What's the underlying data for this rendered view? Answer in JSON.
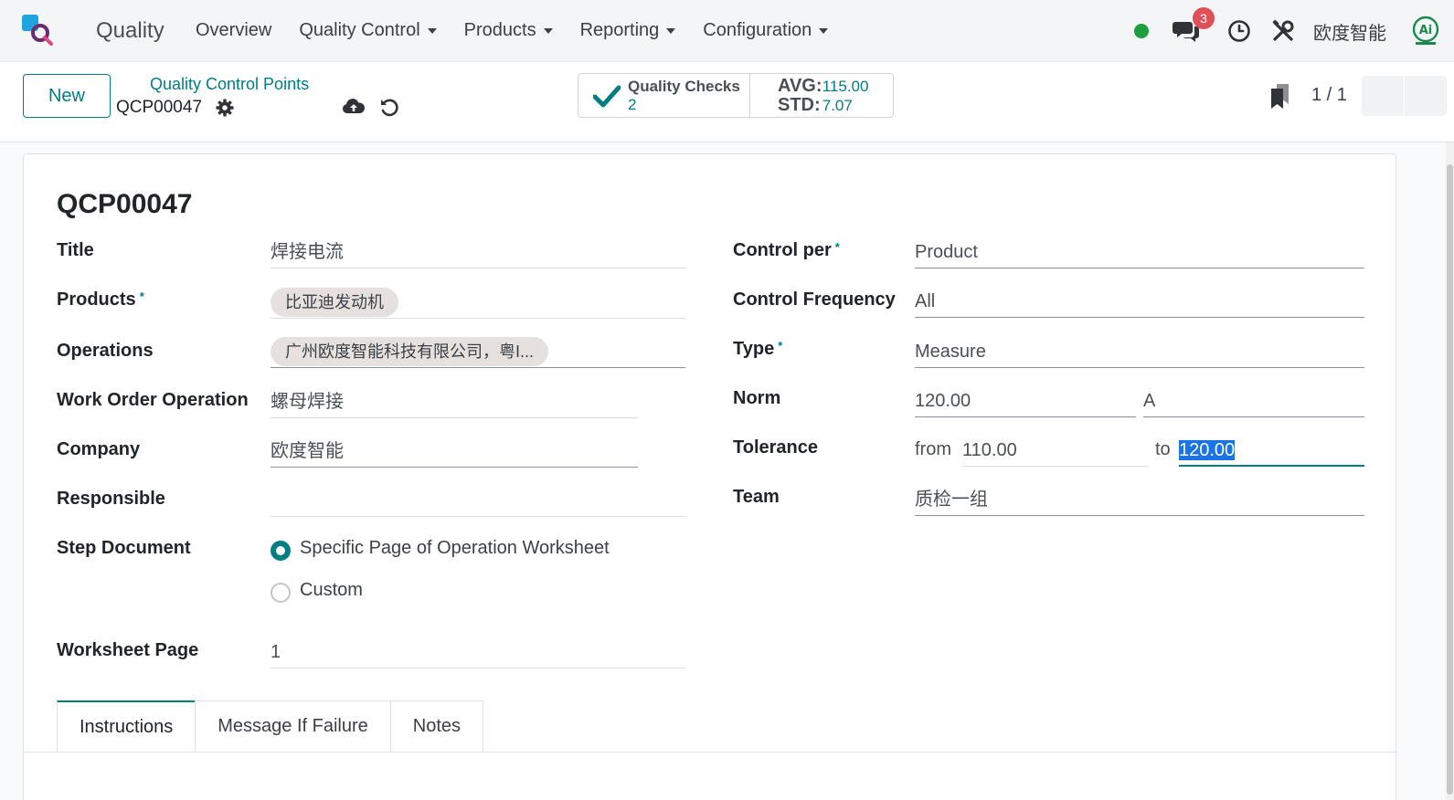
{
  "navbar": {
    "app_name": "Quality",
    "menu": [
      {
        "label": "Overview",
        "dropdown": false
      },
      {
        "label": "Quality Control",
        "dropdown": true
      },
      {
        "label": "Products",
        "dropdown": true
      },
      {
        "label": "Reporting",
        "dropdown": true
      },
      {
        "label": "Configuration",
        "dropdown": true
      }
    ],
    "message_count": "3",
    "company": "欧度智能",
    "presence_color": "#1e9e3e"
  },
  "control_panel": {
    "new_label": "New",
    "breadcrumb_parent": "Quality Control Points",
    "breadcrumb_current": "QCP00047",
    "stats": {
      "checks_label": "Quality Checks",
      "checks_value": "2",
      "avg_label": "AVG:",
      "avg_value": "115.00",
      "std_label": "STD:",
      "std_value": "7.07"
    },
    "pager": "1 / 1"
  },
  "form": {
    "record_name": "QCP00047",
    "left": {
      "title_label": "Title",
      "title_value": "焊接电流",
      "products_label": "Products",
      "products_tag": "比亚迪发动机",
      "operations_label": "Operations",
      "operations_tag": "广州欧度智能科技有限公司，粤I...",
      "wo_operation_label": "Work Order Operation",
      "wo_operation_value": "螺母焊接",
      "company_label": "Company",
      "company_value": "欧度智能",
      "responsible_label": "Responsible",
      "responsible_value": "",
      "step_document_label": "Step Document",
      "step_option_1": "Specific Page of Operation Worksheet",
      "step_option_2": "Custom",
      "worksheet_page_label": "Worksheet Page",
      "worksheet_page_value": "1"
    },
    "right": {
      "control_per_label": "Control per",
      "control_per_value": "Product",
      "frequency_label": "Control Frequency",
      "frequency_value": "All",
      "type_label": "Type",
      "type_value": "Measure",
      "norm_label": "Norm",
      "norm_value": "120.00",
      "norm_unit": "A",
      "tolerance_label": "Tolerance",
      "tol_from_label": "from",
      "tol_from_value": "110.00",
      "tol_to_label": "to",
      "tol_to_value": "120.00",
      "team_label": "Team",
      "team_value": "质检一组"
    },
    "tabs": [
      "Instructions",
      "Message If Failure",
      "Notes"
    ]
  },
  "accent_color": "#017e84"
}
